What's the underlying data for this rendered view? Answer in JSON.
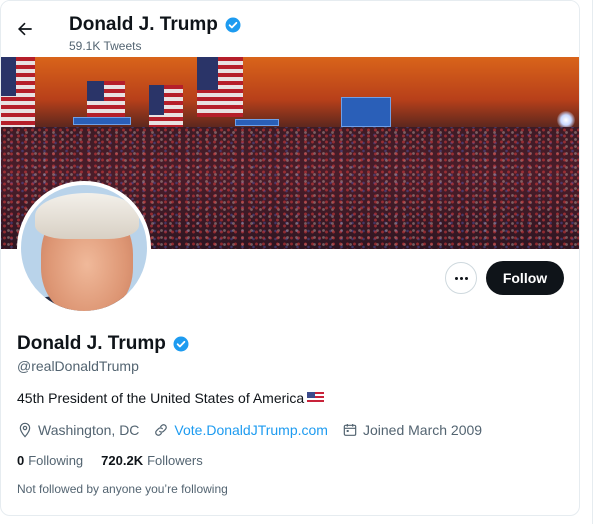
{
  "header": {
    "title": "Donald J. Trump",
    "tweet_count": "59.1K Tweets"
  },
  "profile": {
    "name": "Donald J. Trump",
    "handle": "@realDonaldTrump",
    "bio": "45th President of the United States of America",
    "bio_emoji": "us-flag-emoji",
    "location": "Washington, DC",
    "website": "Vote.DonaldJTrump.com",
    "joined": "Joined March 2009",
    "following_count": "0",
    "following_label": "Following",
    "followers_count": "720.2K",
    "followers_label": "Followers",
    "followed_by_note": "Not followed by anyone you’re following",
    "verified": true
  },
  "actions": {
    "follow_label": "Follow",
    "more_icon": "more-icon"
  },
  "colors": {
    "verified_blue": "#1d9bf0",
    "link_blue": "#1d9bf0",
    "button_dark": "#0f1419",
    "secondary_text": "#536471"
  }
}
